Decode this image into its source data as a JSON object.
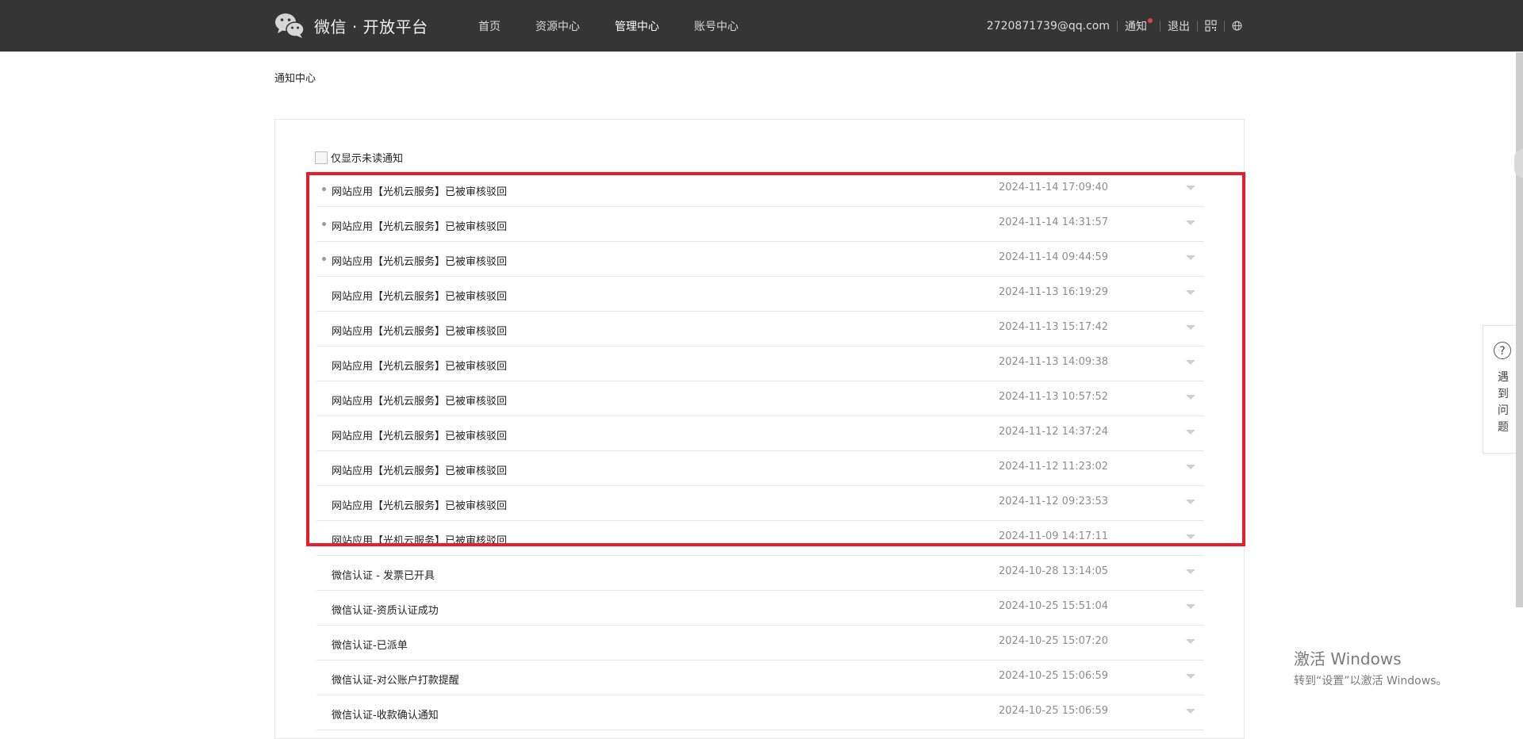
{
  "header": {
    "brand": "微信 · 开放平台",
    "nav": [
      {
        "label": "首页",
        "active": false
      },
      {
        "label": "资源中心",
        "active": false
      },
      {
        "label": "管理中心",
        "active": true
      },
      {
        "label": "账号中心",
        "active": false
      }
    ],
    "user_email": "2720871739@qq.com",
    "notify_label": "通知",
    "logout_label": "退出"
  },
  "breadcrumb": "通知中心",
  "filter": {
    "label": "仅显示未读通知",
    "checked": false
  },
  "notifications": [
    {
      "title": "网站应用【光机云服务】已被审核驳回",
      "time": "2024-11-14 17:09:40",
      "unread": true
    },
    {
      "title": "网站应用【光机云服务】已被审核驳回",
      "time": "2024-11-14 14:31:57",
      "unread": true
    },
    {
      "title": "网站应用【光机云服务】已被审核驳回",
      "time": "2024-11-14 09:44:59",
      "unread": true
    },
    {
      "title": "网站应用【光机云服务】已被审核驳回",
      "time": "2024-11-13 16:19:29",
      "unread": false
    },
    {
      "title": "网站应用【光机云服务】已被审核驳回",
      "time": "2024-11-13 15:17:42",
      "unread": false
    },
    {
      "title": "网站应用【光机云服务】已被审核驳回",
      "time": "2024-11-13 14:09:38",
      "unread": false
    },
    {
      "title": "网站应用【光机云服务】已被审核驳回",
      "time": "2024-11-13 10:57:52",
      "unread": false
    },
    {
      "title": "网站应用【光机云服务】已被审核驳回",
      "time": "2024-11-12 14:37:24",
      "unread": false
    },
    {
      "title": "网站应用【光机云服务】已被审核驳回",
      "time": "2024-11-12 11:23:02",
      "unread": false
    },
    {
      "title": "网站应用【光机云服务】已被审核驳回",
      "time": "2024-11-12 09:23:53",
      "unread": false
    },
    {
      "title": "网站应用【光机云服务】已被审核驳回",
      "time": "2024-11-09 14:17:11",
      "unread": false
    },
    {
      "title": "微信认证 - 发票已开具",
      "time": "2024-10-28 13:14:05",
      "unread": false
    },
    {
      "title": "微信认证-资质认证成功",
      "time": "2024-10-25 15:51:04",
      "unread": false
    },
    {
      "title": "微信认证-已派单",
      "time": "2024-10-25 15:07:20",
      "unread": false
    },
    {
      "title": "微信认证-对公账户打款提醒",
      "time": "2024-10-25 15:06:59",
      "unread": false
    },
    {
      "title": "微信认证-收款确认通知",
      "time": "2024-10-25 15:06:59",
      "unread": false
    }
  ],
  "help": {
    "icon": "?",
    "label": "遇到问题"
  },
  "watermark": {
    "line1": "激活 Windows",
    "line2": "转到“设置”以激活 Windows。"
  },
  "colors": {
    "topbar": "#353535",
    "highlight": "#e81c2a",
    "unread_dot": "#9a9a9a"
  },
  "icons": [
    "wechat-logo-icon",
    "qrcode-icon",
    "globe-icon",
    "chevron-down-icon",
    "help-icon"
  ]
}
